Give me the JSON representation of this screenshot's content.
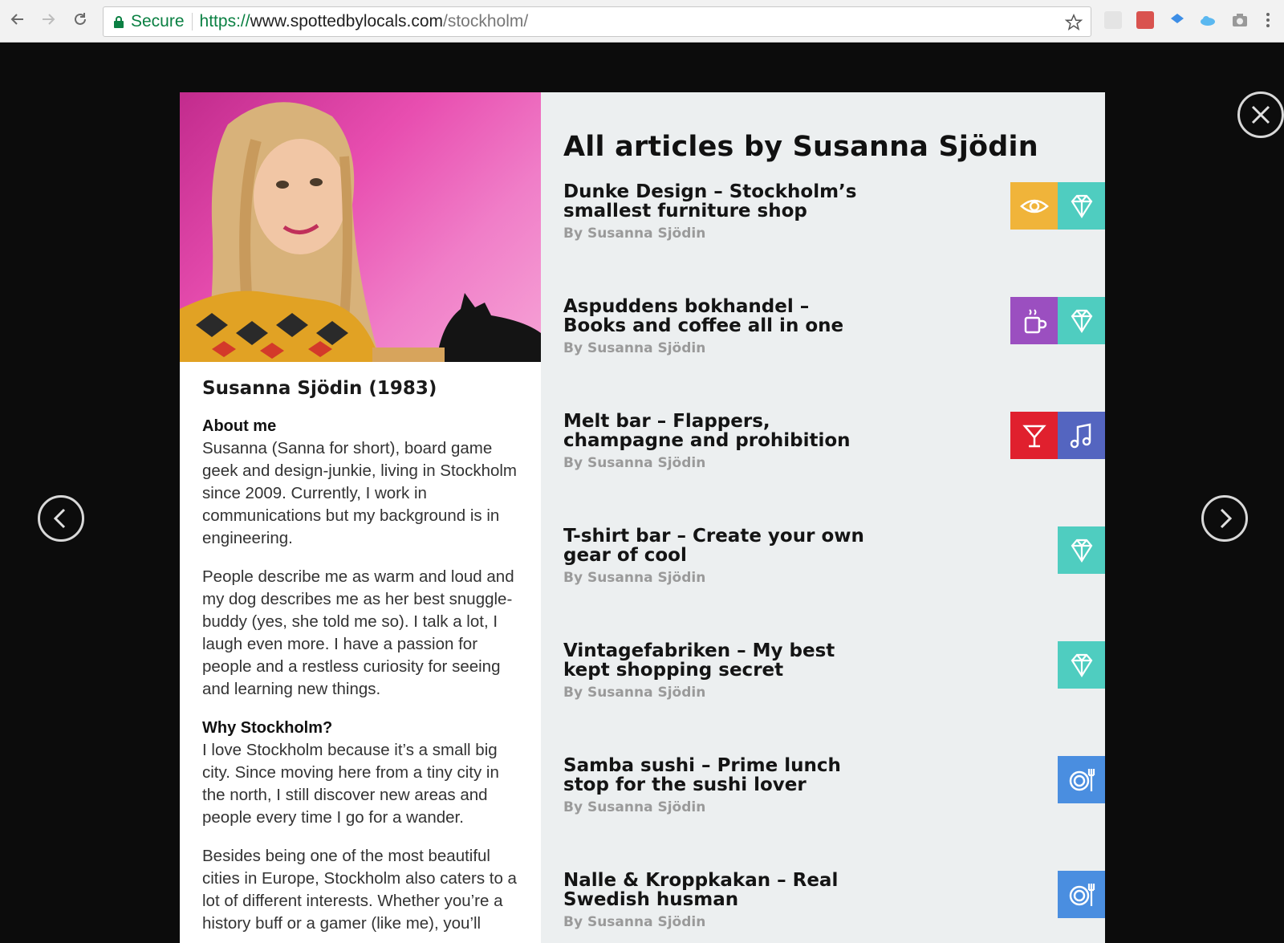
{
  "browser": {
    "secure_label": "Secure",
    "url_scheme": "https://",
    "url_host": "www.spottedbylocals.com",
    "url_path": "/stockholm/",
    "extensions": [
      "mail-extension-icon",
      "red-extension-icon",
      "blue-extension-icon",
      "cloud-extension-icon",
      "camera-extension-icon"
    ]
  },
  "profile": {
    "name": "Susanna Sjödin (1983)",
    "about_heading": "About me",
    "about_text": "Susanna (Sanna for short), board game geek and design-junkie, living in Stockholm since 2009. Currently, I work in communications but my background is in engineering.",
    "about_text_2": "People describe me as warm and loud and my dog describes me as her best snuggle-buddy (yes, she told me so). I talk a lot, I laugh even more. I have a passion for people and a restless curiosity for seeing and learning new things.",
    "why_heading": "Why Stockholm?",
    "why_text": "I love Stockholm because it’s a small big city. Since moving here from a tiny city in the north, I still discover new areas and people every time I go for a wander.",
    "why_text_2": "Besides being one of the most beautiful cities in Europe, Stockholm also caters to a lot of different interests. Whether you’re a history buff or a gamer (like me), you’ll"
  },
  "articles_heading": "All articles by Susanna Sjödin",
  "articles": [
    {
      "title": "Dunke Design – Stockholm’s smallest furniture shop",
      "byline": "By Susanna Sjödin",
      "categories": [
        "eye",
        "diamond"
      ]
    },
    {
      "title": "Aspuddens bokhandel – Books and coffee all in one",
      "byline": "By Susanna Sjödin",
      "categories": [
        "coffee",
        "diamond"
      ]
    },
    {
      "title": "Melt bar – Flappers, champagne and prohibition",
      "byline": "By Susanna Sjödin",
      "categories": [
        "cocktail",
        "music"
      ]
    },
    {
      "title": "T-shirt bar – Create your own gear of cool",
      "byline": "By Susanna Sjödin",
      "categories": [
        "diamond"
      ]
    },
    {
      "title": "Vintagefabriken – My best kept shopping secret",
      "byline": "By Susanna Sjödin",
      "categories": [
        "diamond"
      ]
    },
    {
      "title": "Samba sushi – Prime lunch stop for the sushi lover",
      "byline": "By Susanna Sjödin",
      "categories": [
        "food"
      ]
    },
    {
      "title": "Nalle & Kroppkakan – Real Swedish husman",
      "byline": "By Susanna Sjödin",
      "categories": [
        "food"
      ]
    }
  ],
  "category_colors": {
    "eye": "#f0b43a",
    "diamond": "#4fcdc0",
    "coffee": "#9b4fc0",
    "cocktail": "#e0202e",
    "music": "#5465c0",
    "food": "#4a8ee0"
  }
}
